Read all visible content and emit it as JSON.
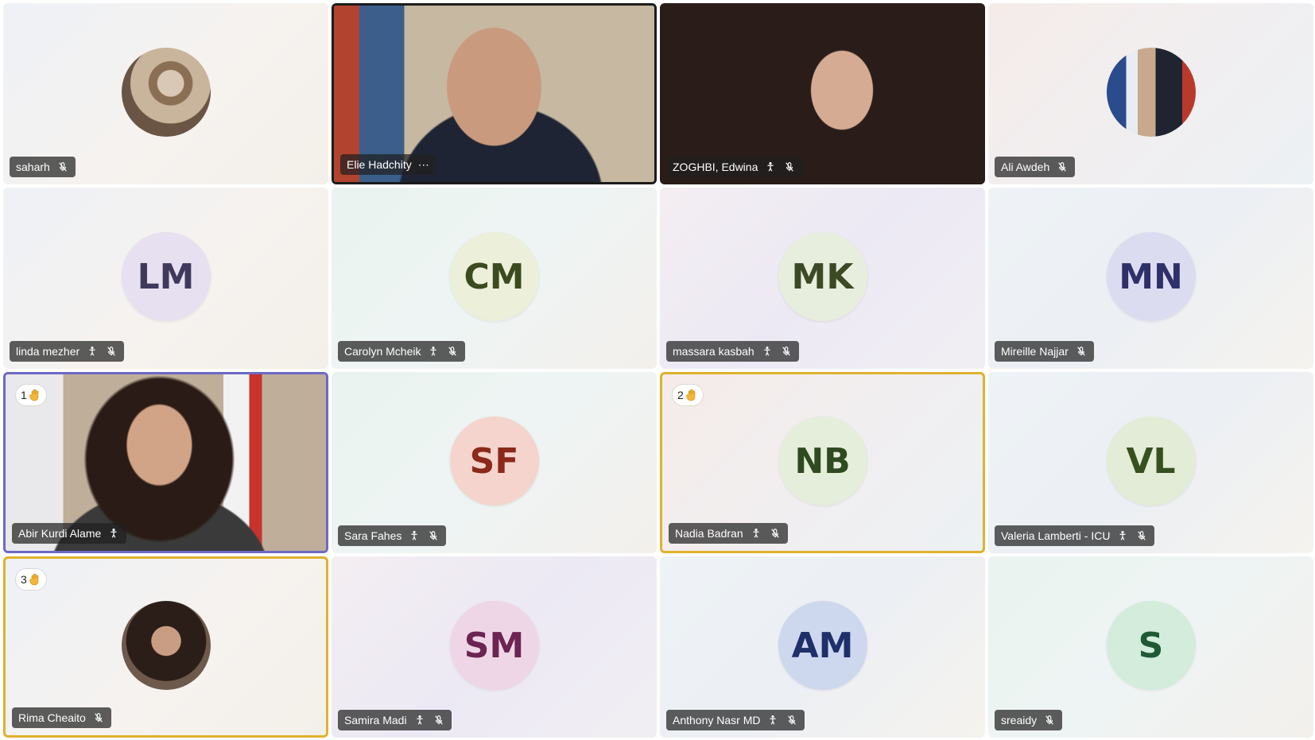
{
  "participants": [
    {
      "name": "saharh",
      "initials": "",
      "raised_hand": ""
    },
    {
      "name": "Elie Hadchity",
      "initials": "",
      "raised_hand": ""
    },
    {
      "name": "ZOGHBI, Edwina",
      "initials": "",
      "raised_hand": ""
    },
    {
      "name": "Ali Awdeh",
      "initials": "",
      "raised_hand": ""
    },
    {
      "name": "linda mezher",
      "initials": "LM",
      "raised_hand": ""
    },
    {
      "name": "Carolyn Mcheik",
      "initials": "CM",
      "raised_hand": ""
    },
    {
      "name": "massara kasbah",
      "initials": "MK",
      "raised_hand": ""
    },
    {
      "name": "Mireille Najjar",
      "initials": "MN",
      "raised_hand": ""
    },
    {
      "name": "Abir Kurdi Alame",
      "initials": "",
      "raised_hand": "1"
    },
    {
      "name": "Sara Fahes",
      "initials": "SF",
      "raised_hand": ""
    },
    {
      "name": "Nadia Badran",
      "initials": "NB",
      "raised_hand": "2"
    },
    {
      "name": "Valeria Lamberti - ICU",
      "initials": "VL",
      "raised_hand": ""
    },
    {
      "name": "Rima Cheaito",
      "initials": "",
      "raised_hand": "3"
    },
    {
      "name": "Samira Madi",
      "initials": "SM",
      "raised_hand": ""
    },
    {
      "name": "Anthony Nasr MD",
      "initials": "AM",
      "raised_hand": ""
    },
    {
      "name": "sreaidy",
      "initials": "S",
      "raised_hand": ""
    }
  ],
  "more_options_label": "⋯",
  "colors": {
    "label_bg": "#202020",
    "raised_hand_border": "#e0b12f",
    "active_border": "#6c69c6",
    "speaking_border": "#1b1b1b"
  },
  "icons": [
    "microphone-muted-icon",
    "hearing-accessibility-icon",
    "raised-hand-icon",
    "more-options-icon"
  ]
}
